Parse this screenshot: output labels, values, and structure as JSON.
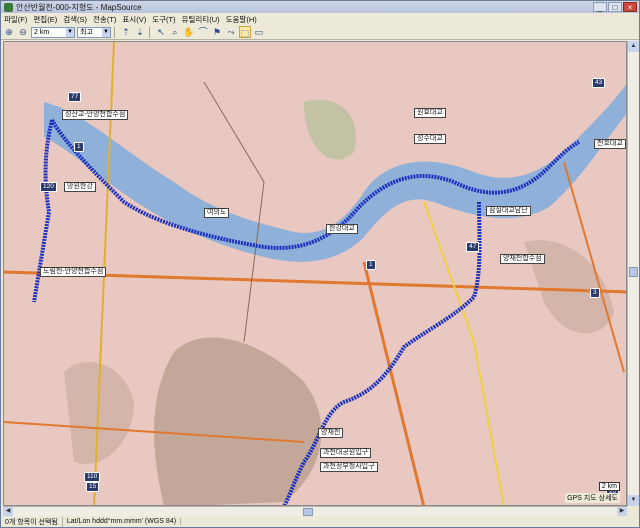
{
  "window": {
    "title": "안산반월천-000-지형도 - MapSource",
    "buttons": [
      "_",
      "□",
      "×"
    ]
  },
  "menu": [
    {
      "label": "파일(F)"
    },
    {
      "label": "편집(E)"
    },
    {
      "label": "검색(S)"
    },
    {
      "label": "전송(T)"
    },
    {
      "label": "표시(V)"
    },
    {
      "label": "도구(T)"
    },
    {
      "label": "유틸리티(U)"
    },
    {
      "label": "도움말(H)"
    }
  ],
  "toolbar": {
    "zoom_in_icon": "zoom-in-icon",
    "zoom_out_icon": "zoom-out-icon",
    "zoom_value": "2 km",
    "detail_value": "최고",
    "tools": [
      "send-icon",
      "receive-icon",
      "pointer-icon",
      "zoom-tool-icon",
      "hand-icon",
      "measure-icon",
      "waypoint-icon",
      "route-icon",
      "track-icon",
      "select-icon",
      "ruler-icon"
    ]
  },
  "map": {
    "colors": {
      "land": "#e8c8c0",
      "river": "#8fb0d8",
      "route": "#1b2fc0",
      "hills": "#9a8a7a"
    },
    "labels": [
      {
        "text": "성산교-안양천합수점"
      },
      {
        "text": "원효대교"
      },
      {
        "text": "성수대교"
      },
      {
        "text": "망원한강"
      },
      {
        "text": "여의도"
      },
      {
        "text": "한강대교"
      },
      {
        "text": "잠실대교남단"
      },
      {
        "text": "양재천합수점"
      },
      {
        "text": "도림천-안양천합수점"
      },
      {
        "text": "양재천"
      },
      {
        "text": "과천대공원입구"
      },
      {
        "text": "과천정부청사입구"
      },
      {
        "text": "천호대교"
      }
    ],
    "shields": [
      "77",
      "1",
      "120",
      "47",
      "1",
      "3",
      "43",
      "110",
      "15",
      "20"
    ],
    "scale_text": "2 km",
    "note": "GPS 지도 상세도"
  },
  "status": {
    "selection": "0개 항목이 선택됨",
    "coord_format": "Lat/Lon hddd°mm.mmm' (WGS 84)"
  }
}
